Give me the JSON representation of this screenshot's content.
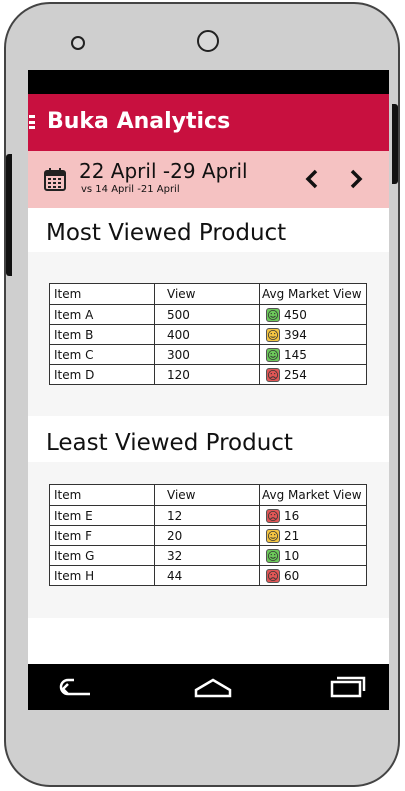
{
  "app": {
    "title": "Buka Analytics"
  },
  "date": {
    "range": "22 April -29 April",
    "compare": "vs 14 April -21 April"
  },
  "colors": {
    "appbar": "#c8103f",
    "datebar": "#f5c2c2",
    "good": "#6cc95a",
    "neutral": "#f4c542",
    "bad": "#e05656"
  },
  "most_viewed": {
    "title": "Most Viewed Product",
    "headers": {
      "item": "Item",
      "view": "View",
      "avg": "Avg Market View"
    },
    "rows": [
      {
        "item": "Item A",
        "view": "500",
        "avg": "450",
        "mood": "good"
      },
      {
        "item": "Item B",
        "view": "400",
        "avg": "394",
        "mood": "neutral"
      },
      {
        "item": "Item C",
        "view": "300",
        "avg": "145",
        "mood": "good"
      },
      {
        "item": "Item D",
        "view": "120",
        "avg": "254",
        "mood": "bad"
      }
    ]
  },
  "least_viewed": {
    "title": "Least Viewed Product",
    "headers": {
      "item": "Item",
      "view": "View",
      "avg": "Avg Market View"
    },
    "rows": [
      {
        "item": "Item E",
        "view": "12",
        "avg": "16",
        "mood": "bad"
      },
      {
        "item": "Item F",
        "view": "20",
        "avg": "21",
        "mood": "neutral"
      },
      {
        "item": "Item G",
        "view": "32",
        "avg": "10",
        "mood": "good"
      },
      {
        "item": "Item H",
        "view": "44",
        "avg": "60",
        "mood": "bad"
      }
    ]
  },
  "icons": {
    "menu": "menu-icon",
    "calendar": "calendar-icon",
    "prev": "chevron-left-icon",
    "next": "chevron-right-icon",
    "back": "back-icon",
    "home": "home-icon",
    "recent": "recent-apps-icon"
  }
}
